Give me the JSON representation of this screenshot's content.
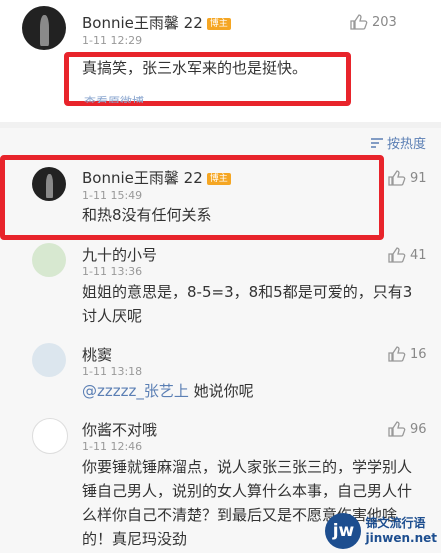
{
  "top_comment": {
    "name": "Bonnie王雨馨 22",
    "badge": "博主",
    "time": "1-11 12:29",
    "likes": "203",
    "text": "真搞笑，张三水军来的也是挺快。",
    "faded_link": "查看原微博"
  },
  "sort": {
    "label": "按热度",
    "icon": "sort-icon"
  },
  "comments": [
    {
      "name": "Bonnie王雨馨 22",
      "badge": "博主",
      "time": "1-11 15:49",
      "likes": "91",
      "text": "和热8没有任何关系",
      "avatar": "dark-avatar"
    },
    {
      "name": "九十的小号",
      "time": "1-11 13:36",
      "likes": "41",
      "text": "姐姐的意思是，8-5=3，8和5都是可爱的，只有3讨人厌呢",
      "avatar": "girl-avatar"
    },
    {
      "name": "桃窦",
      "time": "1-11 13:18",
      "likes": "16",
      "mention": "@zzzzz_张艺上",
      "text": " 她说你呢",
      "avatar": "anime-avatar"
    },
    {
      "name": "你酱不对哦",
      "time": "1-11 12:46",
      "likes": "96",
      "text": "你要锤就锤麻溜点，说人家张三张三的，学学别人锤自己男人，说别的女人算什么本事，自己男人什么样你自己不清楚？到最后又是不愿意伤害他啥的！真尼玛没劲",
      "avatar": "meme-avatar"
    }
  ],
  "watermark": {
    "logo": "jw",
    "line1": "锦文流行语",
    "line2": "jinwen.net"
  },
  "colors": {
    "highlight": "#e8242b",
    "link": "#5b7fb4"
  }
}
